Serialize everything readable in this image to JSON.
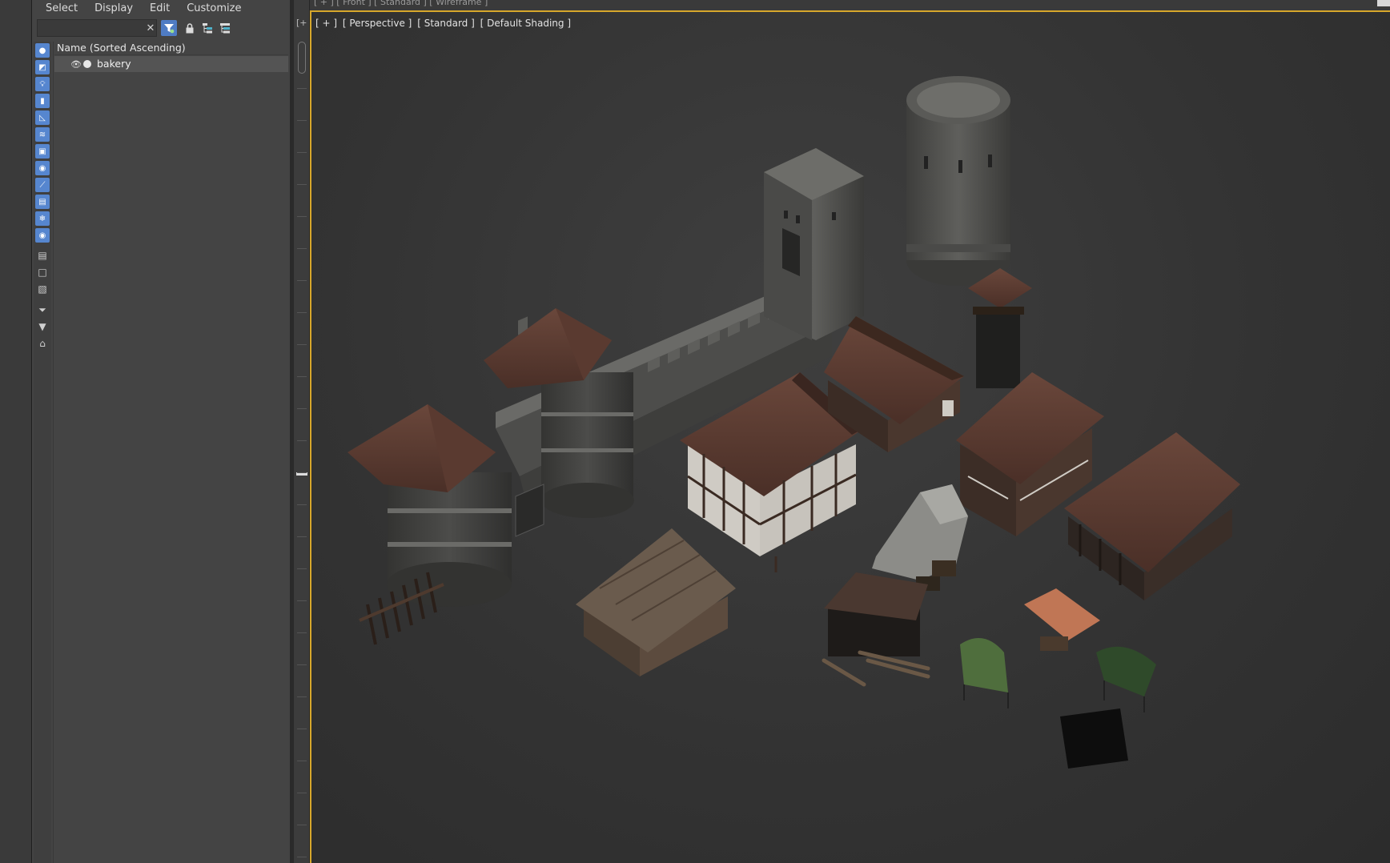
{
  "menubar": [
    "Select",
    "Display",
    "Edit",
    "Customize"
  ],
  "search": {
    "value": "",
    "placeholder": ""
  },
  "list": {
    "header": "Name (Sorted Ascending)",
    "rows": [
      {
        "name": "bakery"
      }
    ]
  },
  "top_viewport": {
    "label": "[ + ] [ Front ] [ Standard ] [ Wireframe ]"
  },
  "viewport": {
    "labels": [
      "[ + ]",
      "[ Perspective ]",
      "[ Standard ]",
      "[ Default Shading ]"
    ]
  },
  "colors": {
    "panel_bg": "#444444",
    "accent_blue": "#5686cf",
    "viewport_border": "#d7a72b",
    "roof_brown": "#5c3a30",
    "stone_grey": "#5a5a58",
    "timber_white": "#d9d6cf"
  },
  "filter_icons": [
    "geometry-icon",
    "shapes-icon",
    "lights-icon",
    "cameras-icon",
    "helpers-icon",
    "space-warps-icon",
    "groups-icon",
    "xrefs-icon",
    "bones-icon",
    "containers-icon",
    "frozen-icon",
    "hidden-icon"
  ]
}
